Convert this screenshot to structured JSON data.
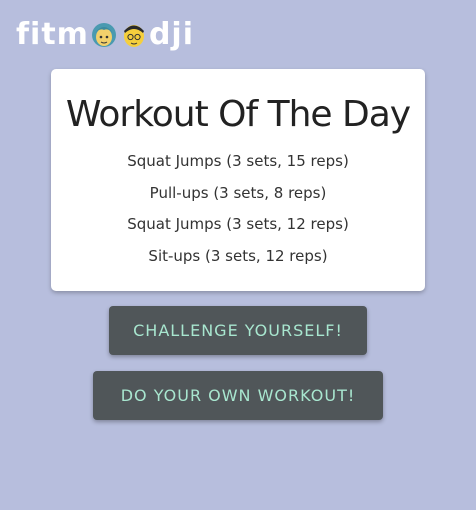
{
  "logo": {
    "prefix": "fitm",
    "suffix": "dji",
    "icons": [
      "girl-emoji-icon",
      "boy-emoji-icon"
    ]
  },
  "workout": {
    "title": "Workout Of The Day",
    "exercises": [
      "Squat Jumps (3 sets, 15 reps)",
      "Pull-ups (3 sets, 8 reps)",
      "Squat Jumps (3 sets, 12 reps)",
      "Sit-ups (3 sets, 12 reps)"
    ]
  },
  "buttons": {
    "challenge_label": "CHALLENGE YOURSELF!",
    "own_workout_label": "DO YOUR OWN WORKOUT!"
  },
  "colors": {
    "background": "#b7bedd",
    "button_bg": "#505659",
    "button_text": "#a8e6cf"
  }
}
